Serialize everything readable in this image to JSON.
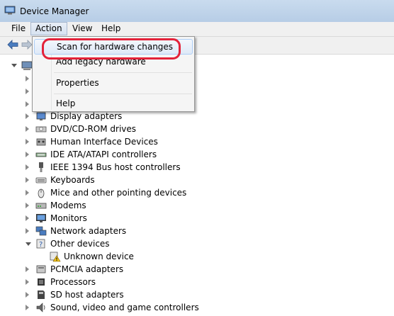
{
  "window": {
    "title": "Device Manager"
  },
  "menubar": {
    "items": [
      {
        "label": "File"
      },
      {
        "label": "Action",
        "active": true
      },
      {
        "label": "View"
      },
      {
        "label": "Help"
      }
    ]
  },
  "action_menu": {
    "items": [
      {
        "label": "Scan for hardware changes",
        "highlighted": true,
        "annotated": true
      },
      {
        "label": "Add legacy hardware"
      },
      {
        "label": "Properties"
      },
      {
        "label": "Help"
      }
    ]
  },
  "tree": {
    "items": [
      {
        "label": "Display adapters",
        "icon": "display-icon",
        "expanded": false
      },
      {
        "label": "DVD/CD-ROM drives",
        "icon": "disc-drive-icon",
        "expanded": false
      },
      {
        "label": "Human Interface Devices",
        "icon": "hid-icon",
        "expanded": false
      },
      {
        "label": "IDE ATA/ATAPI controllers",
        "icon": "ide-icon",
        "expanded": false
      },
      {
        "label": "IEEE 1394 Bus host controllers",
        "icon": "firewire-icon",
        "expanded": false
      },
      {
        "label": "Keyboards",
        "icon": "keyboard-icon",
        "expanded": false
      },
      {
        "label": "Mice and other pointing devices",
        "icon": "mouse-icon",
        "expanded": false
      },
      {
        "label": "Modems",
        "icon": "modem-icon",
        "expanded": false
      },
      {
        "label": "Monitors",
        "icon": "monitor-icon",
        "expanded": false
      },
      {
        "label": "Network adapters",
        "icon": "network-icon",
        "expanded": false
      },
      {
        "label": "Other devices",
        "icon": "other-devices-icon",
        "expanded": true
      },
      {
        "label": "Unknown device",
        "icon": "warning-device-icon",
        "child": true
      },
      {
        "label": "PCMCIA adapters",
        "icon": "pcmcia-icon",
        "expanded": false
      },
      {
        "label": "Processors",
        "icon": "processor-icon",
        "expanded": false
      },
      {
        "label": "SD host adapters",
        "icon": "sd-icon",
        "expanded": false
      },
      {
        "label": "Sound, video and game controllers",
        "icon": "speaker-icon",
        "expanded": false
      }
    ]
  },
  "colors": {
    "annotation": "#e3223a",
    "titlebar": "#c9dbee",
    "menu_highlight": "#dfe9f7"
  }
}
